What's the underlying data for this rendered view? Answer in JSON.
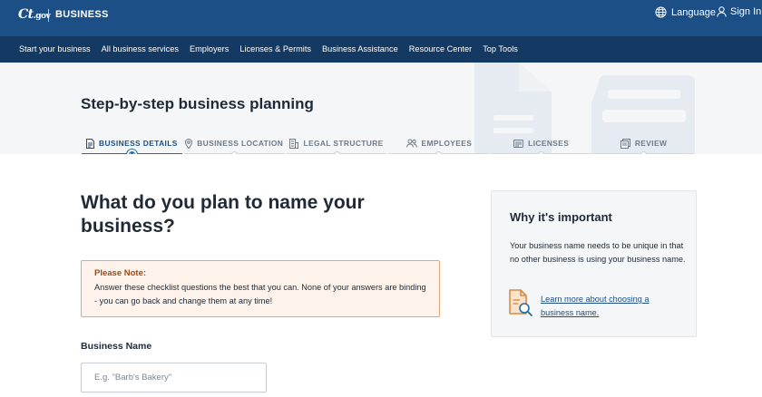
{
  "header": {
    "logo_ct": "Ct",
    "logo_gov": ".gov",
    "section": "BUSINESS",
    "language_label": "Language",
    "signin_label": "Sign In"
  },
  "nav": {
    "items": [
      "Start your business",
      "All business services",
      "Employers",
      "Licenses & Permits",
      "Business Assistance",
      "Resource Center",
      "Top Tools"
    ]
  },
  "hero": {
    "title": "Step-by-step business planning"
  },
  "steps": [
    {
      "label": "BUSINESS DETAILS",
      "icon": "document-icon",
      "active": true
    },
    {
      "label": "BUSINESS LOCATION",
      "icon": "location-pin-icon",
      "active": false
    },
    {
      "label": "LEGAL STRUCTURE",
      "icon": "building-icon",
      "active": false
    },
    {
      "label": "EMPLOYEES",
      "icon": "people-icon",
      "active": false
    },
    {
      "label": "LICENSES",
      "icon": "license-card-icon",
      "active": false
    },
    {
      "label": "REVIEW",
      "icon": "review-icon",
      "active": false
    }
  ],
  "main": {
    "question": "What do you plan to name your business?",
    "note_title": "Please Note:",
    "note_text": "Answer these checklist questions the best that you can. None of your answers are binding - you can go back and change them at any time!",
    "field_label": "Business Name",
    "field_placeholder": "E.g. \"Barb's Bakery\"",
    "field_value": ""
  },
  "sidebar": {
    "title": "Why it's important",
    "text": "Your business name needs to be unique in that no other business is using your business name.",
    "link": "Learn more about choosing a business name."
  },
  "colors": {
    "header_bg": "#1c4f86",
    "nav_bg": "#143a63",
    "accent": "#1c6ea4",
    "note_border": "#e2a774",
    "note_bg": "#fdf3ea",
    "icon_orange": "#d98a45"
  }
}
